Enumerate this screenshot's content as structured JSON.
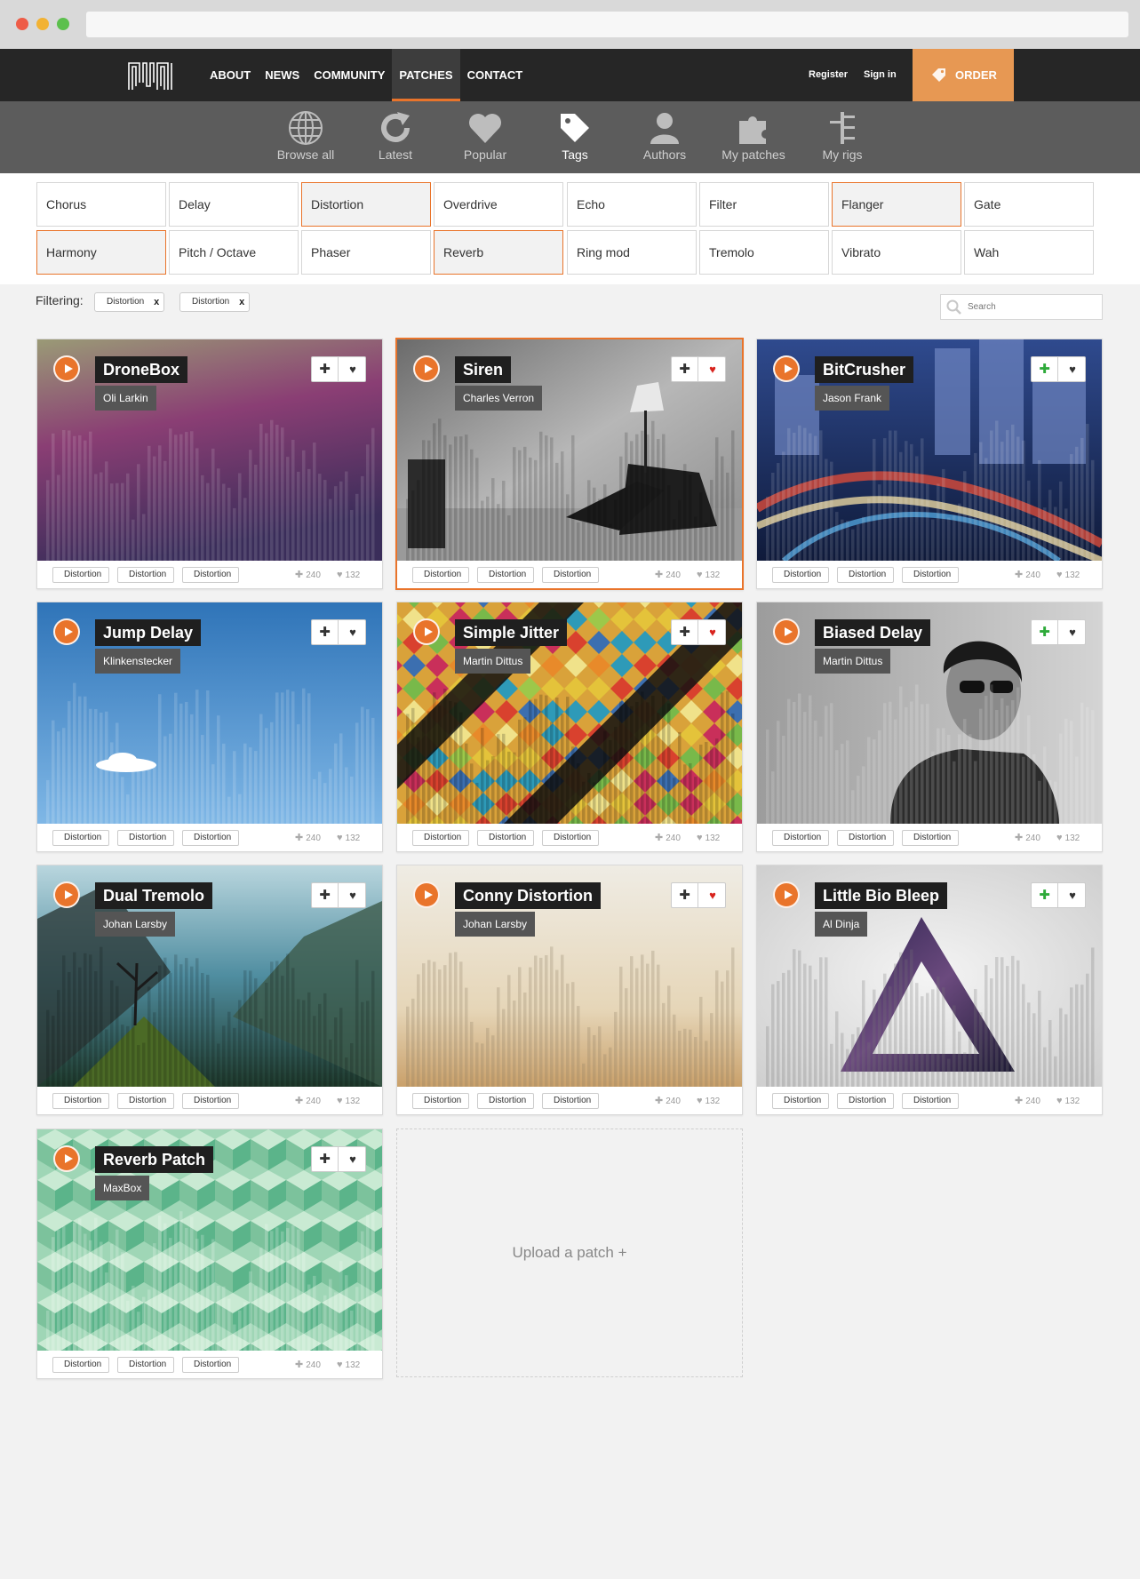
{
  "nav": {
    "links": [
      "ABOUT",
      "NEWS",
      "COMMUNITY",
      "PATCHES",
      "CONTACT"
    ],
    "register": "Register",
    "signin": "Sign in",
    "order": "ORDER"
  },
  "subnav": [
    {
      "label": "Browse all",
      "icon": "globe-icon"
    },
    {
      "label": "Latest",
      "icon": "refresh-icon"
    },
    {
      "label": "Popular",
      "icon": "heart-icon"
    },
    {
      "label": "Tags",
      "icon": "tag-icon"
    },
    {
      "label": "Authors",
      "icon": "user-icon"
    },
    {
      "label": "My patches",
      "icon": "puzzle-icon"
    },
    {
      "label": "My rigs",
      "icon": "tree-icon"
    }
  ],
  "tags": [
    "Chorus",
    "Delay",
    "Distortion",
    "Overdrive",
    "Echo",
    "Filter",
    "Flanger",
    "Gate",
    "Harmony",
    "Pitch / Octave",
    "Phaser",
    "Reverb",
    "Ring mod",
    "Tremolo",
    "Vibrato",
    "Wah"
  ],
  "selected_tags": [
    "Distortion",
    "Flanger",
    "Harmony",
    "Reverb"
  ],
  "filter": {
    "label": "Filtering:",
    "chips": [
      "Distortion",
      "Distortion"
    ],
    "remove": "x",
    "search_placeholder": "Search"
  },
  "patches": [
    {
      "title": "DroneBox",
      "author": "Oli Larkin"
    },
    {
      "title": "Siren",
      "author": "Charles Verron"
    },
    {
      "title": "BitCrusher",
      "author": "Jason Frank"
    },
    {
      "title": "Jump Delay",
      "author": "Klinkenstecker"
    },
    {
      "title": "Simple Jitter",
      "author": "Martin Dittus"
    },
    {
      "title": "Biased Delay",
      "author": "Martin Dittus"
    },
    {
      "title": "Dual Tremolo",
      "author": "Johan Larsby"
    },
    {
      "title": "Conny Distortion",
      "author": "Johan Larsby"
    },
    {
      "title": "Little Bio Bleep",
      "author": "Al Dinja"
    },
    {
      "title": "Reverb Patch",
      "author": "MaxBox"
    }
  ],
  "card_common": {
    "tags": [
      "Distortion",
      "Distortion",
      "Distortion"
    ],
    "adds": "240",
    "likes": "132",
    "add_symbol": "✚",
    "like_symbol": "♥"
  },
  "upload_label": "Upload a patch +",
  "colors": {
    "accent": "#e9742b",
    "order_bg": "#e79853",
    "nav_bg": "#262626",
    "subnav_bg": "#5c5c5c"
  }
}
